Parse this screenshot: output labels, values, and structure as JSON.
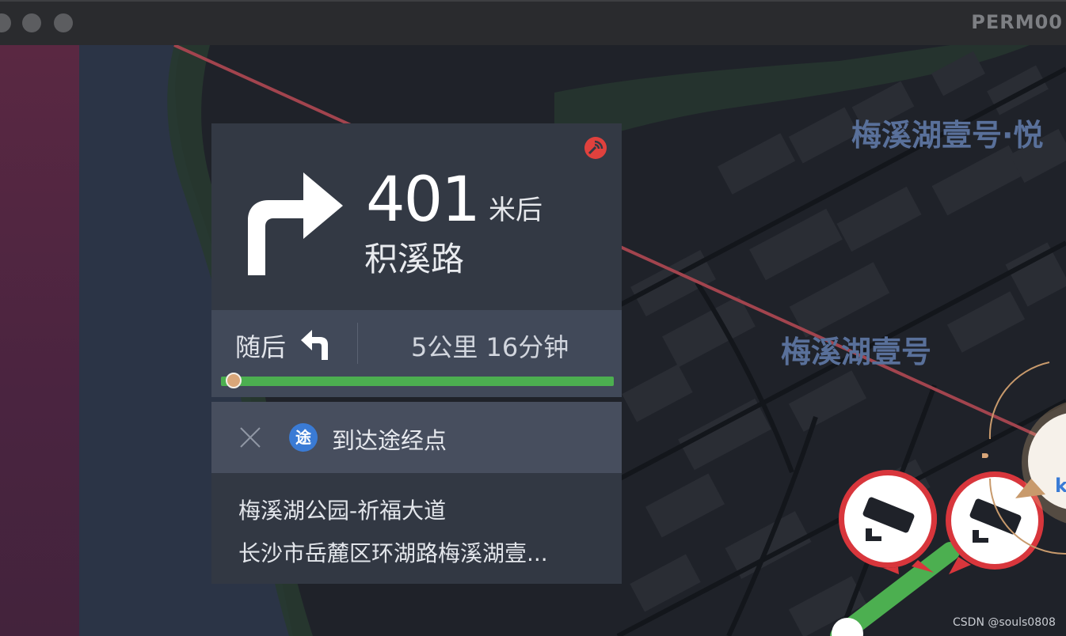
{
  "window": {
    "title": "PERM00"
  },
  "navigation": {
    "distance_value": "401",
    "distance_unit": "米后",
    "road_name": "积溪路",
    "next_label": "随后",
    "remaining": "5公里 16分钟",
    "progress": 0.02
  },
  "waypoint": {
    "badge": "途",
    "label": "到达途经点"
  },
  "destination": {
    "name": "梅溪湖公园-祈福大道",
    "address": "长沙市岳麓区环湖路梅溪湖壹..."
  },
  "map": {
    "labels": [
      "梅溪湖壹号·悦",
      "梅溪湖壹号"
    ],
    "marker_text": "k"
  },
  "watermark": "CSDN @souls0808",
  "icons": {
    "main_turn": "turn-right-icon",
    "next_turn": "turn-left-icon",
    "gps": "gps-signal-icon",
    "close": "close-icon",
    "camera": "traffic-camera-icon"
  },
  "colors": {
    "route": "#4caf50",
    "camera_ring": "#d8363c",
    "gps_icon": "#e0413d",
    "via_badge": "#3a7bd5"
  }
}
